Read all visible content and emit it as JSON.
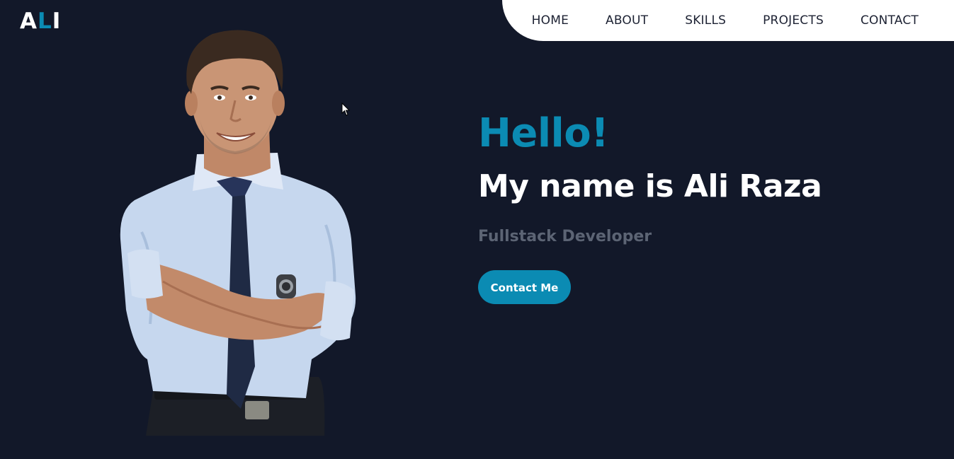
{
  "logo": {
    "prefix": "A",
    "accent": "L",
    "suffix": "I"
  },
  "nav": {
    "items": [
      {
        "label": "HOME"
      },
      {
        "label": "ABOUT"
      },
      {
        "label": "SKILLS"
      },
      {
        "label": "PROJECTS"
      },
      {
        "label": "CONTACT"
      }
    ]
  },
  "hero": {
    "greeting": "Hello!",
    "name": "My name is Ali Raza",
    "role": "Fullstack Developer",
    "cta_label": "Contact Me"
  },
  "colors": {
    "background": "#121829",
    "accent": "#0b8bb3",
    "nav_background": "#ffffff",
    "muted_text": "#5c6474"
  },
  "icons": {
    "cursor": "mouse-pointer-icon"
  }
}
